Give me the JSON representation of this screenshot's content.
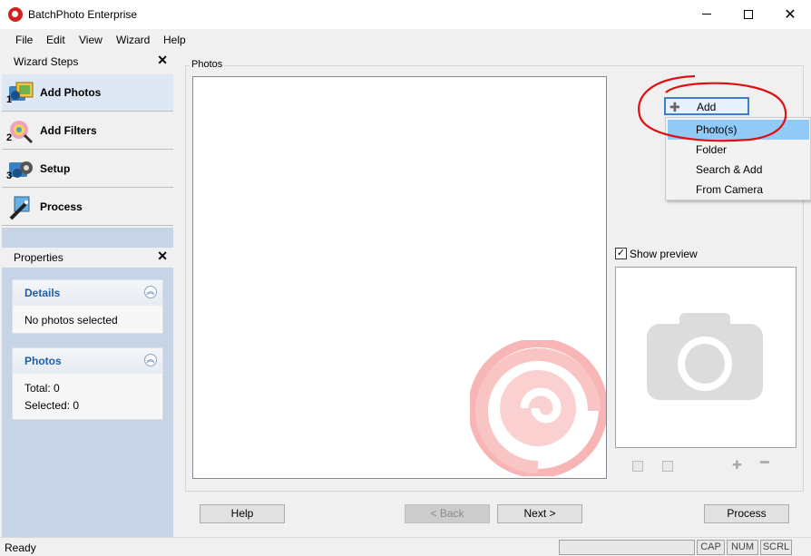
{
  "window": {
    "title": "BatchPhoto Enterprise"
  },
  "menu": [
    "File",
    "Edit",
    "View",
    "Wizard",
    "Help"
  ],
  "wizard_steps": {
    "title": "Wizard Steps",
    "steps": [
      {
        "num": "1",
        "label": "Add Photos",
        "icon": "add-photos-icon"
      },
      {
        "num": "2",
        "label": "Add Filters",
        "icon": "add-filters-icon"
      },
      {
        "num": "3",
        "label": "Setup",
        "icon": "setup-icon"
      },
      {
        "num": "",
        "label": "Process",
        "icon": "process-icon"
      }
    ]
  },
  "properties": {
    "title": "Properties",
    "details": {
      "title": "Details",
      "text": "No photos selected"
    },
    "photos": {
      "title": "Photos",
      "total": "Total: 0",
      "selected": "Selected: 0"
    }
  },
  "photos_group": {
    "label": "Photos"
  },
  "add_button": {
    "label": "Add"
  },
  "add_menu": {
    "items": [
      "Photo(s)",
      "Folder",
      "Search & Add",
      "From Camera"
    ],
    "selected_index": 0
  },
  "preview": {
    "label": "Show preview",
    "checked": true
  },
  "buttons": {
    "help": "Help",
    "back": "< Back",
    "next": "Next >",
    "process": "Process"
  },
  "status": {
    "text": "Ready",
    "cap": "CAP",
    "num": "NUM",
    "scrl": "SCRL"
  },
  "colors": {
    "accent": "#3c7fd1",
    "selection": "#91c9f7",
    "annotation": "#e01010",
    "brand": "#d32020"
  }
}
